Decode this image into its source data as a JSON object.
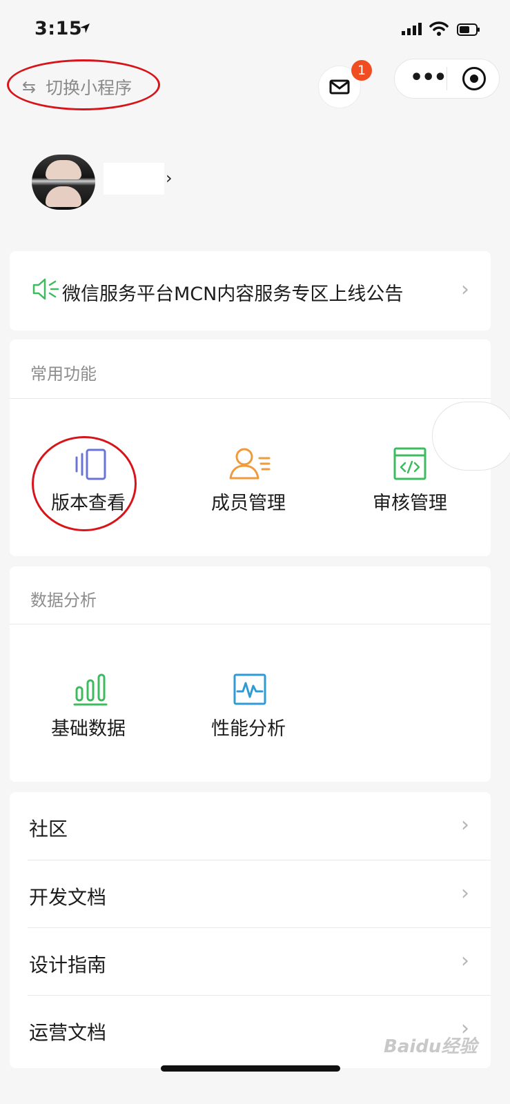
{
  "status_bar": {
    "time": "3:15"
  },
  "top_nav": {
    "switch_label": "切换小程序",
    "mail_badge": "1"
  },
  "announcement": {
    "text": "微信服务平台MCN内容服务专区上线公告"
  },
  "common_functions": {
    "title": "常用功能",
    "items": [
      {
        "label": "版本查看",
        "icon": "version-icon",
        "color": "#6b74d6"
      },
      {
        "label": "成员管理",
        "icon": "member-icon",
        "color": "#ef9a3c"
      },
      {
        "label": "审核管理",
        "icon": "code-review-icon",
        "color": "#3dbb5e"
      }
    ]
  },
  "data_analysis": {
    "title": "数据分析",
    "items": [
      {
        "label": "基础数据",
        "icon": "bar-chart-icon",
        "color": "#3dbb5e"
      },
      {
        "label": "性能分析",
        "icon": "performance-icon",
        "color": "#2f9bd6"
      }
    ]
  },
  "menu": {
    "items": [
      {
        "label": "社区"
      },
      {
        "label": "开发文档"
      },
      {
        "label": "设计指南"
      },
      {
        "label": "运营文档"
      }
    ]
  },
  "colors": {
    "annotation_red": "#d7141a",
    "badge_red": "#f04d23",
    "brand_green": "#3dbb5e"
  }
}
